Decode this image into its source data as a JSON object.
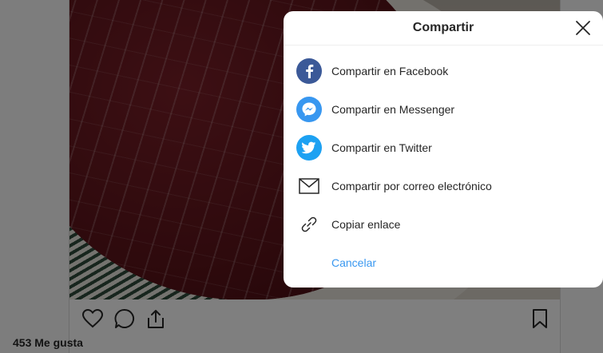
{
  "post": {
    "likes_label": "453 Me gusta"
  },
  "share_dialog": {
    "title": "Compartir",
    "options": [
      {
        "label": "Compartir en Facebook",
        "icon": "facebook-icon",
        "color": "#3b5998"
      },
      {
        "label": "Compartir en Messenger",
        "icon": "messenger-icon",
        "color": "#3897f0"
      },
      {
        "label": "Compartir en Twitter",
        "icon": "twitter-icon",
        "color": "#1da1f2"
      },
      {
        "label": "Compartir por correo electrónico",
        "icon": "email-icon"
      },
      {
        "label": "Copiar enlace",
        "icon": "link-icon"
      }
    ],
    "cancel_label": "Cancelar"
  },
  "colors": {
    "accent": "#3897f0",
    "text": "#262626",
    "overlay": "rgba(0,0,0,0.5)"
  }
}
